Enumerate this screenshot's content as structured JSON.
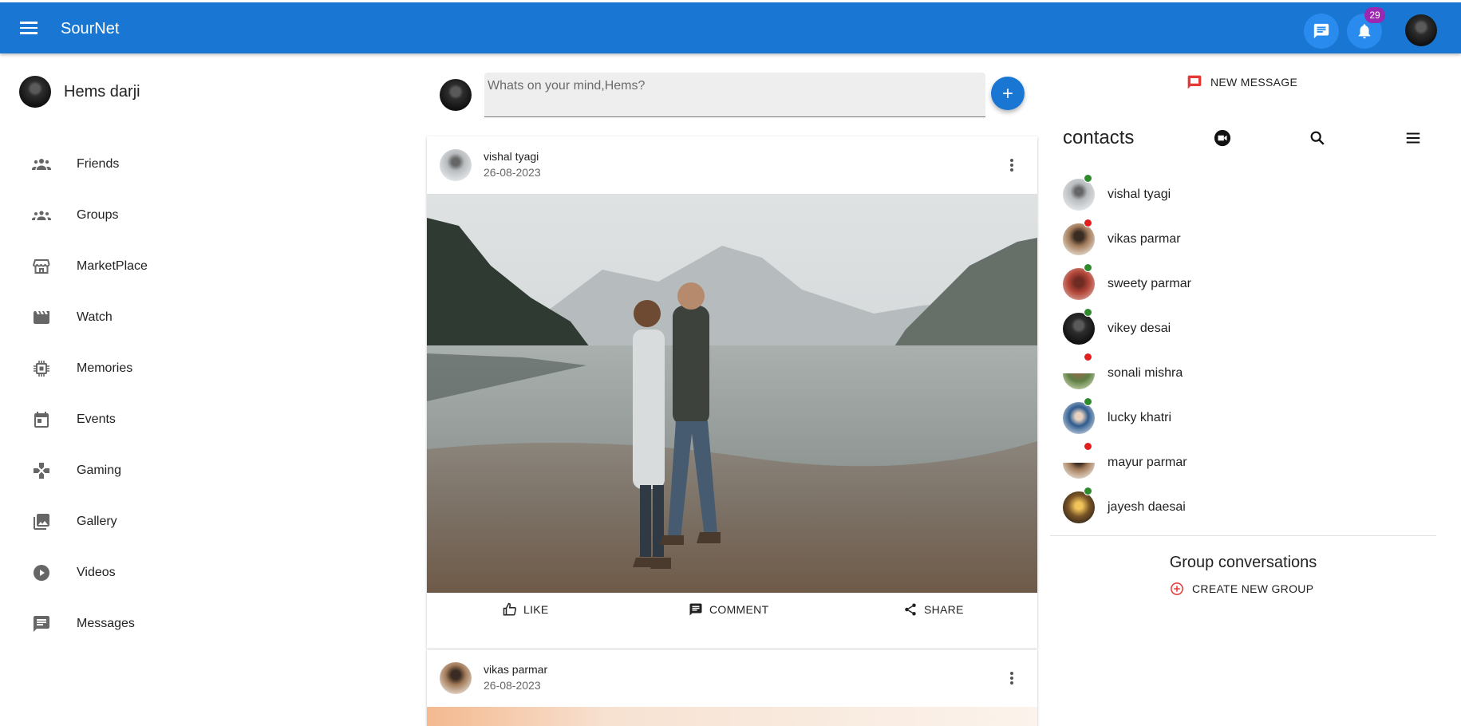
{
  "app": {
    "brand": "SourNet",
    "notification_count": "29"
  },
  "profile": {
    "name": "Hems darji"
  },
  "nav": [
    {
      "label": "Friends",
      "icon": "people-icon"
    },
    {
      "label": "Groups",
      "icon": "groups-icon"
    },
    {
      "label": "MarketPlace",
      "icon": "store-icon"
    },
    {
      "label": "Watch",
      "icon": "movie-icon"
    },
    {
      "label": "Memories",
      "icon": "memory-chip-icon"
    },
    {
      "label": "Events",
      "icon": "calendar-icon"
    },
    {
      "label": "Gaming",
      "icon": "gamepad-icon"
    },
    {
      "label": "Gallery",
      "icon": "photo-library-icon"
    },
    {
      "label": "Videos",
      "icon": "play-circle-icon"
    },
    {
      "label": "Messages",
      "icon": "chat-icon"
    }
  ],
  "composer": {
    "placeholder": "Whats on your mind,Hems?"
  },
  "posts": [
    {
      "author": "vishal tyagi",
      "date": "26-08-2023"
    },
    {
      "author": "vikas parmar",
      "date": "26-08-2023"
    }
  ],
  "post_actions": {
    "like": "LIKE",
    "comment": "COMMENT",
    "share": "SHARE"
  },
  "right": {
    "new_message": "NEW MESSAGE",
    "contacts_title": "contacts",
    "contacts": [
      {
        "name": "vishal tyagi",
        "status_color": "#2e8b2e"
      },
      {
        "name": "vikas parmar",
        "status_color": "#e02020"
      },
      {
        "name": "sweety parmar",
        "status_color": "#2e8b2e"
      },
      {
        "name": "vikey desai",
        "status_color": "#2e8b2e"
      },
      {
        "name": "sonali mishra",
        "status_color": "#e02020"
      },
      {
        "name": "lucky khatri",
        "status_color": "#2e8b2e"
      },
      {
        "name": "mayur parmar",
        "status_color": "#e02020"
      },
      {
        "name": "jayesh daesai",
        "status_color": "#2e8b2e"
      }
    ],
    "group_title": "Group conversations",
    "create_group": "CREATE NEW GROUP"
  },
  "colors": {
    "primary": "#1976d2",
    "badge": "#9c27b0",
    "online": "#2e8b2e",
    "offline": "#e02020",
    "create_icon": "#e53935"
  }
}
